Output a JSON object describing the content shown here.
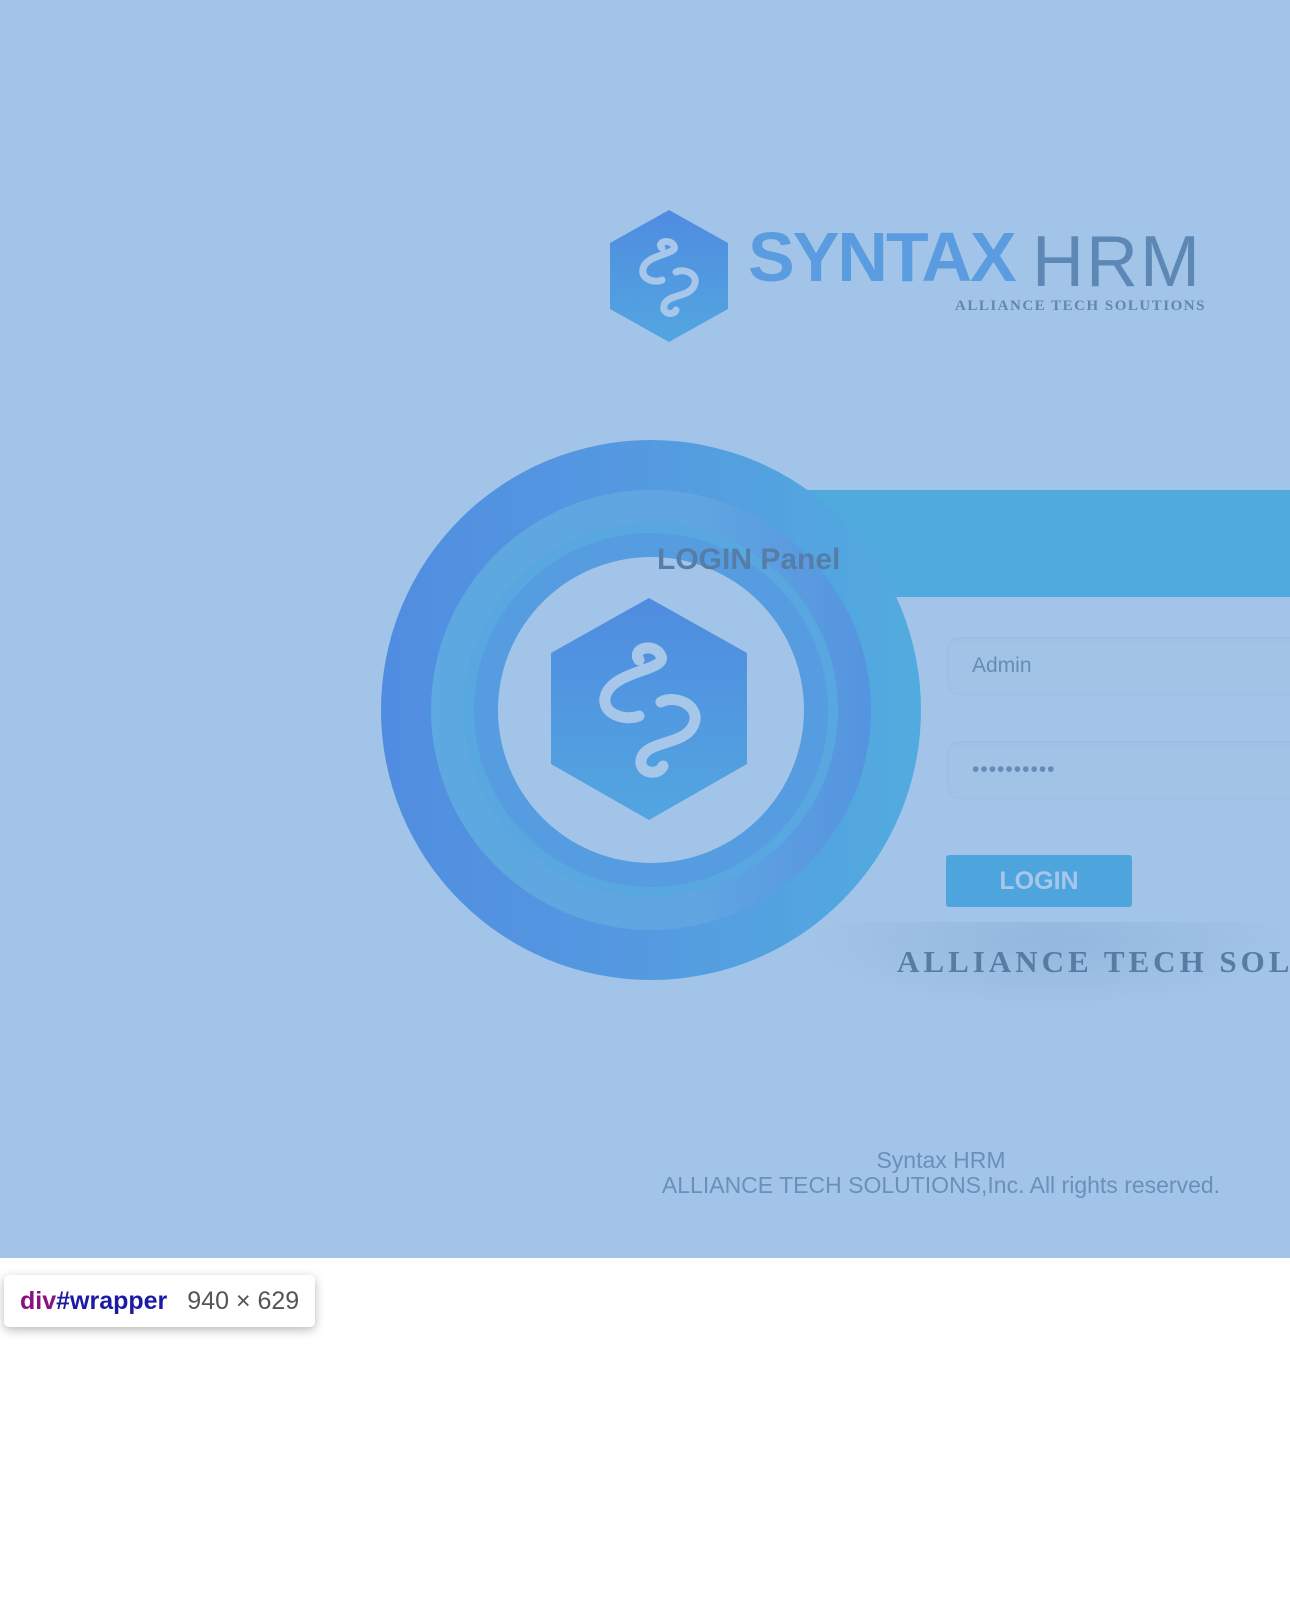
{
  "logo": {
    "word1": "SYNTAX",
    "word2": "HRM",
    "tagline": "ALLIANCE TECH SOLUTIONS"
  },
  "login": {
    "title": "LOGIN Panel",
    "username_value": "Admin",
    "password_value": "••••••••••",
    "button_label": "LOGIN",
    "brand_text": "ALLIANCE TECH SOLUTIONS"
  },
  "footer": {
    "line1": "Syntax HRM",
    "line2": "ALLIANCE TECH SOLUTIONS,Inc. All rights reserved."
  },
  "inspector": {
    "tag": "div",
    "id": "#wrapper",
    "size": "940 × 629"
  }
}
